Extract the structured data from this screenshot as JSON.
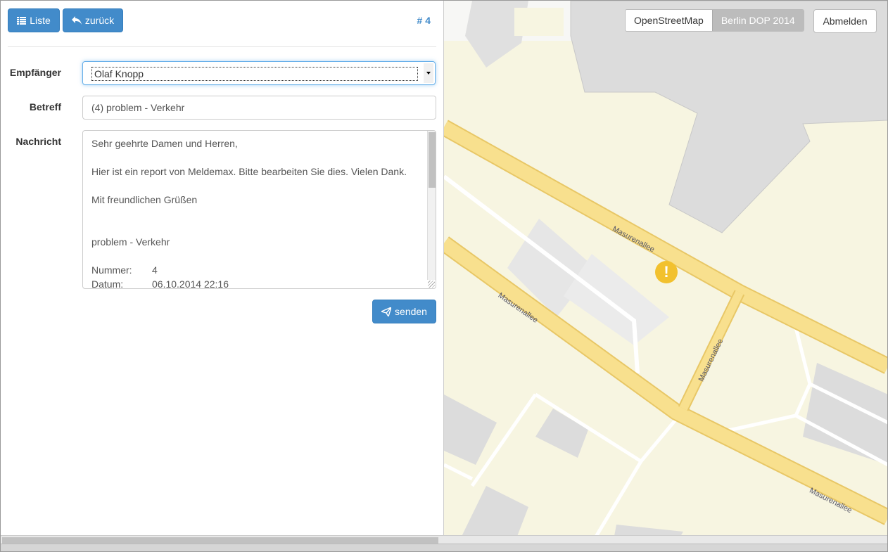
{
  "toolbar": {
    "list_label": "Liste",
    "back_label": "zurück",
    "ticket_number": "# 4"
  },
  "form": {
    "recipient_label": "Empfänger",
    "recipient_value": "Olaf Knopp",
    "subject_label": "Betreff",
    "subject_value": "(4) problem - Verkehr",
    "message_label": "Nachricht",
    "message_lines": {
      "greeting": "Sehr geehrte Damen und Herren,",
      "body": "Hier ist ein report von Meldemax. Bitte bearbeiten Sie dies. Vielen Dank.",
      "closing": "Mit freundlichen Grüßen",
      "category": "problem - Verkehr",
      "number_label": "Nummer:",
      "number_value": "4",
      "date_label": "Datum:",
      "date_value": "06.10.2014 22:16"
    },
    "send_label": "senden"
  },
  "map": {
    "layers": {
      "osm": "OpenStreetMap",
      "dop": "Berlin DOP 2014",
      "active": "Berlin DOP 2014"
    },
    "logout_label": "Abmelden",
    "marker_symbol": "!",
    "street_name": "Masurenallee",
    "colors": {
      "road": "#f8e08e",
      "road_edge": "#e8c766",
      "building": "#d9d9d9",
      "land": "#f7f5e1",
      "marker": "#f2c12e"
    }
  },
  "colors": {
    "primary": "#428bca"
  }
}
